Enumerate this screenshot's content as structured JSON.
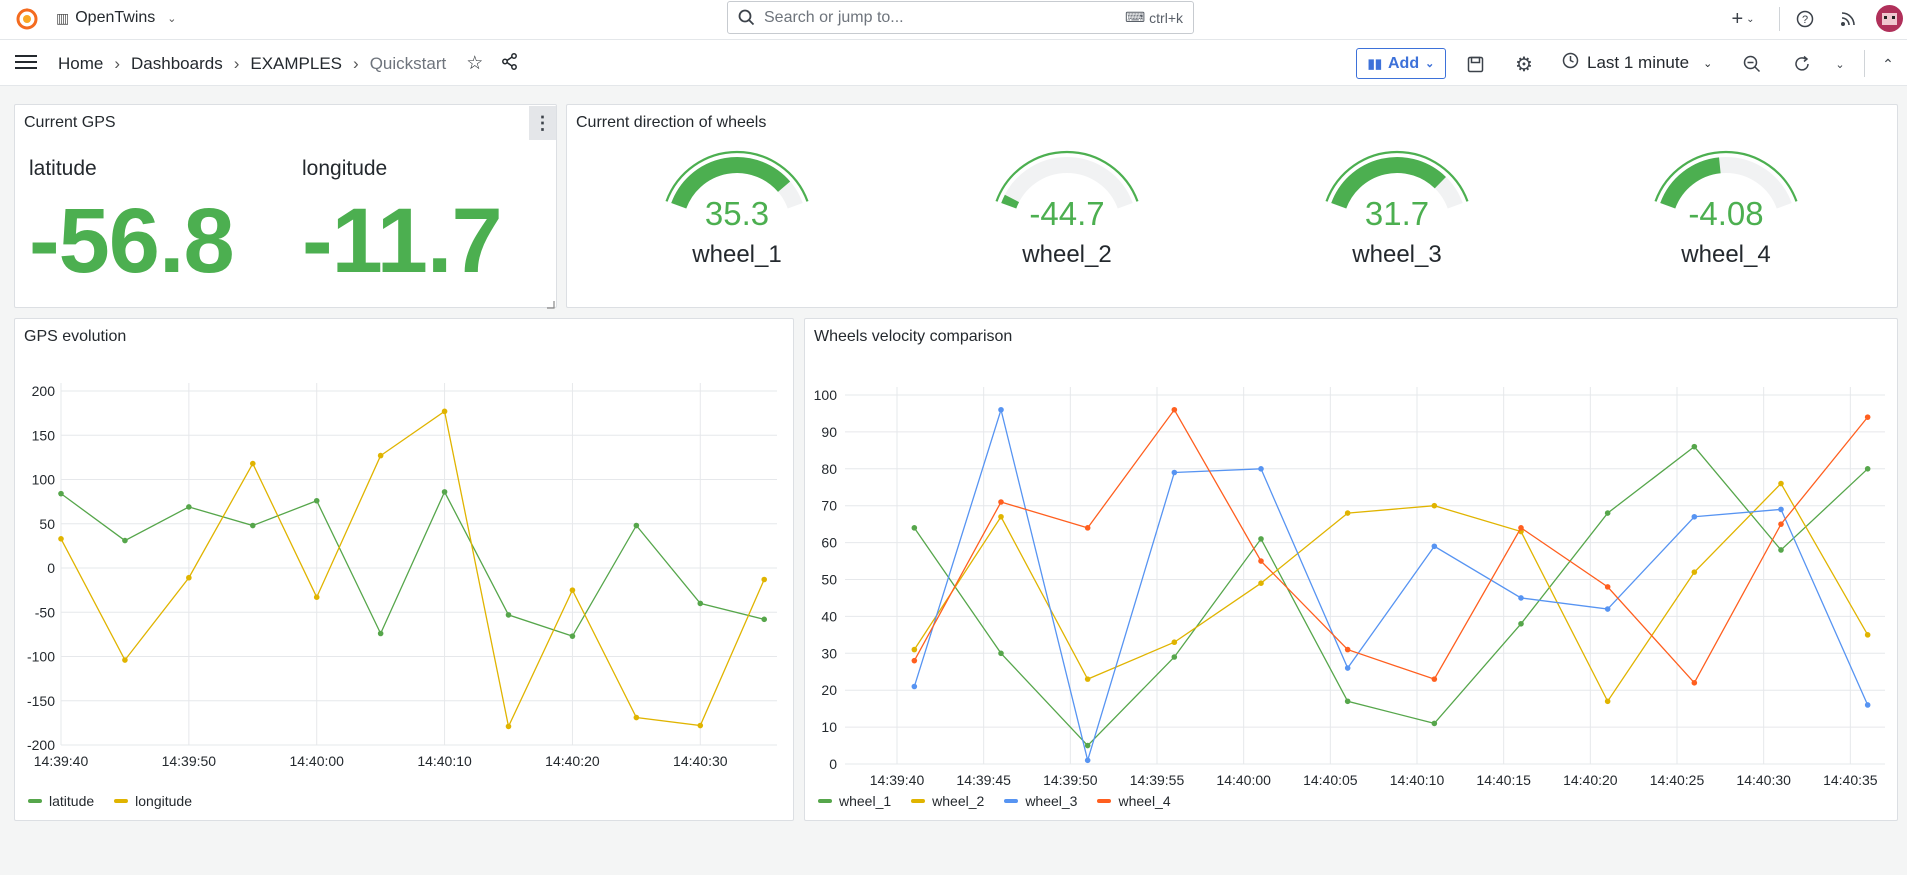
{
  "app": {
    "name": "OpenTwins",
    "logo_icon": "grafana-logo-icon"
  },
  "search": {
    "placeholder": "Search or jump to...",
    "shortcut": "ctrl+k"
  },
  "breadcrumb": [
    "Home",
    "Dashboards",
    "EXAMPLES",
    "Quickstart"
  ],
  "toolbar": {
    "add_label": "Add",
    "time_range": "Last 1 minute"
  },
  "colors": {
    "green": "#4caf50",
    "yellow": "#e0b400",
    "blue": "#5794f2",
    "orange": "#ff5f1f",
    "accent": "#3d71d9"
  },
  "gps_panel": {
    "title": "Current GPS",
    "latitude_label": "latitude",
    "latitude_value": "-56.8",
    "longitude_label": "longitude",
    "longitude_value": "-11.7"
  },
  "wheels_panel": {
    "title": "Current direction of wheels",
    "gauges": [
      {
        "name": "wheel_1",
        "value": "35.3",
        "num": 35.3
      },
      {
        "name": "wheel_2",
        "value": "-44.7",
        "num": -44.7
      },
      {
        "name": "wheel_3",
        "value": "31.7",
        "num": 31.7
      },
      {
        "name": "wheel_4",
        "value": "-4.08",
        "num": -4.08
      }
    ]
  },
  "chart_data": [
    {
      "type": "line",
      "title": "GPS evolution",
      "x_ticks": [
        "14:39:40",
        "14:39:50",
        "14:40:00",
        "14:40:10",
        "14:40:20",
        "14:40:30"
      ],
      "x_range": [
        "14:39:40",
        "14:40:36"
      ],
      "ylim": [
        -200,
        200
      ],
      "y_ticks": [
        200,
        150,
        100,
        50,
        0,
        -50,
        -100,
        -150,
        -200
      ],
      "grid": true,
      "legend": "bottom-left",
      "x": [
        "14:39:40",
        "14:39:45",
        "14:39:50",
        "14:39:55",
        "14:40:00",
        "14:40:05",
        "14:40:10",
        "14:40:15",
        "14:40:20",
        "14:40:25",
        "14:40:30",
        "14:40:35"
      ],
      "series": [
        {
          "name": "latitude",
          "color": "#56a64b",
          "values": [
            84,
            31,
            69,
            48,
            76,
            -74,
            86,
            -53,
            -77,
            48,
            -40,
            -58
          ]
        },
        {
          "name": "longitude",
          "color": "#e0b400",
          "values": [
            33,
            -104,
            -11,
            118,
            -33,
            127,
            177,
            -179,
            -25,
            -169,
            -178,
            -13
          ]
        }
      ]
    },
    {
      "type": "line",
      "title": "Wheels velocity comparison",
      "x_ticks": [
        "14:39:40",
        "14:39:45",
        "14:39:50",
        "14:39:55",
        "14:40:00",
        "14:40:05",
        "14:40:10",
        "14:40:15",
        "14:40:20",
        "14:40:25",
        "14:40:30",
        "14:40:35"
      ],
      "x_range": [
        "14:39:37",
        "14:40:37"
      ],
      "ylim": [
        0,
        100
      ],
      "y_ticks": [
        100,
        90,
        80,
        70,
        60,
        50,
        40,
        30,
        20,
        10,
        0
      ],
      "grid": true,
      "legend": "bottom-left",
      "x": [
        "14:39:41",
        "14:39:46",
        "14:39:51",
        "14:39:56",
        "14:40:01",
        "14:40:06",
        "14:40:11",
        "14:40:16",
        "14:40:21",
        "14:40:26",
        "14:40:31",
        "14:40:36"
      ],
      "series": [
        {
          "name": "wheel_1",
          "color": "#56a64b",
          "values": [
            64,
            30,
            5,
            29,
            61,
            17,
            11,
            38,
            68,
            86,
            58,
            80
          ]
        },
        {
          "name": "wheel_2",
          "color": "#e0b400",
          "values": [
            31,
            67,
            23,
            33,
            49,
            68,
            70,
            63,
            17,
            52,
            76,
            35
          ]
        },
        {
          "name": "wheel_3",
          "color": "#5794f2",
          "values": [
            21,
            96,
            1,
            79,
            80,
            26,
            59,
            45,
            42,
            67,
            69,
            16
          ]
        },
        {
          "name": "wheel_4",
          "color": "#ff5f1f",
          "values": [
            28,
            71,
            64,
            96,
            55,
            31,
            23,
            64,
            48,
            22,
            65,
            94
          ]
        }
      ]
    }
  ]
}
